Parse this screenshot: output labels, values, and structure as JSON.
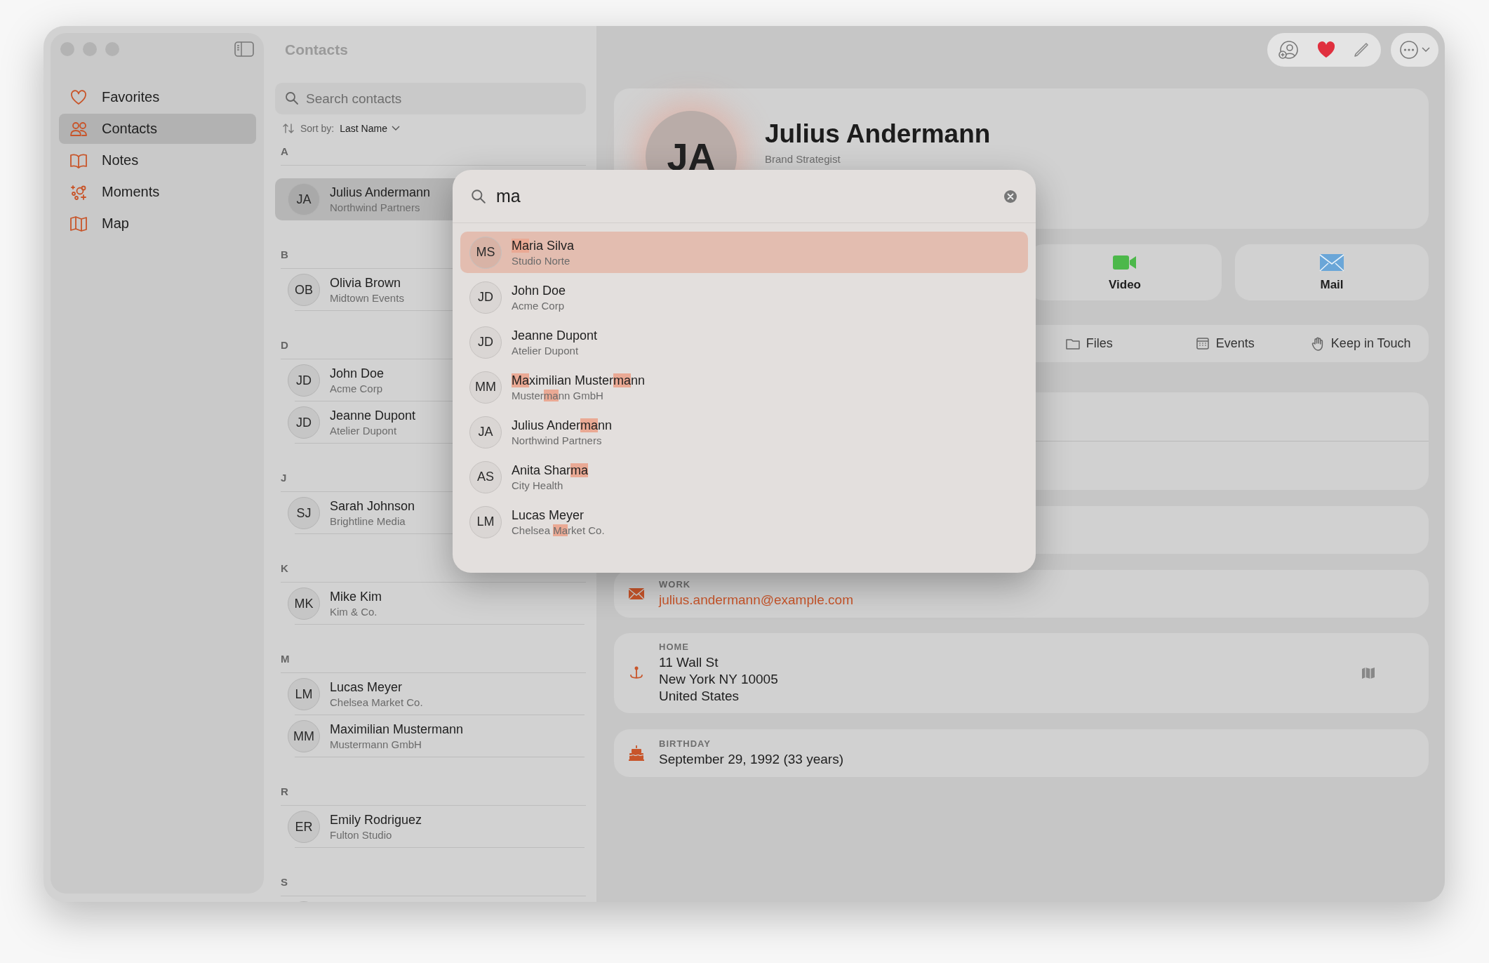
{
  "sidebar": {
    "items": [
      {
        "label": "Favorites",
        "selected": false
      },
      {
        "label": "Contacts",
        "selected": true
      },
      {
        "label": "Notes",
        "selected": false
      },
      {
        "label": "Moments",
        "selected": false
      },
      {
        "label": "Map",
        "selected": false
      }
    ]
  },
  "contact_list": {
    "title": "Contacts",
    "search": {
      "placeholder": "Search contacts"
    },
    "sort": {
      "label": "Sort by:",
      "value": "Last Name"
    },
    "sections": [
      {
        "letter": "A",
        "contacts": [
          {
            "initials": "JA",
            "name": "Julius Andermann",
            "company": "Northwind Partners",
            "selected": true
          }
        ]
      },
      {
        "letter": "B",
        "contacts": [
          {
            "initials": "OB",
            "name": "Olivia Brown",
            "company": "Midtown Events",
            "selected": false
          }
        ]
      },
      {
        "letter": "D",
        "contacts": [
          {
            "initials": "JD",
            "name": "John Doe",
            "company": "Acme Corp",
            "selected": false
          },
          {
            "initials": "JD",
            "name": "Jeanne Dupont",
            "company": "Atelier Dupont",
            "selected": false
          }
        ]
      },
      {
        "letter": "J",
        "contacts": [
          {
            "initials": "SJ",
            "name": "Sarah Johnson",
            "company": "Brightline Media",
            "selected": false
          }
        ]
      },
      {
        "letter": "K",
        "contacts": [
          {
            "initials": "MK",
            "name": "Mike Kim",
            "company": "Kim & Co.",
            "selected": false
          }
        ]
      },
      {
        "letter": "M",
        "contacts": [
          {
            "initials": "LM",
            "name": "Lucas Meyer",
            "company": "Chelsea Market Co.",
            "selected": false
          },
          {
            "initials": "MM",
            "name": "Maximilian Mustermann",
            "company": "Mustermann GmbH",
            "selected": false
          }
        ]
      },
      {
        "letter": "R",
        "contacts": [
          {
            "initials": "ER",
            "name": "Emily Rodriguez",
            "company": "Fulton Studio",
            "selected": false
          }
        ]
      },
      {
        "letter": "S",
        "contacts": [
          {
            "selected": false
          }
        ]
      }
    ]
  },
  "detail": {
    "initials": "JA",
    "name": "Julius Andermann",
    "title": "Brand Strategist",
    "actions": [
      {
        "label": "Video"
      },
      {
        "label": "Mail"
      }
    ],
    "tabs": [
      {
        "label": "Files"
      },
      {
        "label": "Events"
      },
      {
        "label": "Keep in Touch"
      }
    ],
    "fields": [
      {
        "kind": "email",
        "label": "WORK",
        "lines": [
          "julius.andermann@example.com"
        ]
      },
      {
        "kind": "address",
        "label": "HOME",
        "lines": [
          "11 Wall St",
          "New York NY 10005",
          "United States"
        ]
      },
      {
        "kind": "date",
        "label": "BIRTHDAY",
        "lines": [
          "September 29, 1992 (33 years)"
        ]
      }
    ]
  },
  "search_popup": {
    "query": "ma",
    "results": [
      {
        "initials": "MS",
        "selected": true,
        "name": [
          {
            "text": "Ma",
            "match": true
          },
          {
            "text": "ria Silva",
            "match": false
          }
        ],
        "company": [
          {
            "text": "Studio Norte",
            "match": false
          }
        ]
      },
      {
        "initials": "JD",
        "selected": false,
        "name": [
          {
            "text": "John Doe",
            "match": false
          }
        ],
        "company": [
          {
            "text": "Acme Corp",
            "match": false
          }
        ]
      },
      {
        "initials": "JD",
        "selected": false,
        "name": [
          {
            "text": "Jeanne Dupont",
            "match": false
          }
        ],
        "company": [
          {
            "text": "Atelier Dupont",
            "match": false
          }
        ]
      },
      {
        "initials": "MM",
        "selected": false,
        "name": [
          {
            "text": "Ma",
            "match": true
          },
          {
            "text": "ximilian Muster",
            "match": false
          },
          {
            "text": "ma",
            "match": true
          },
          {
            "text": "nn",
            "match": false
          }
        ],
        "company": [
          {
            "text": "Muster",
            "match": false
          },
          {
            "text": "ma",
            "match": true
          },
          {
            "text": "nn GmbH",
            "match": false
          }
        ]
      },
      {
        "initials": "JA",
        "selected": false,
        "name": [
          {
            "text": "Julius Ander",
            "match": false
          },
          {
            "text": "ma",
            "match": true
          },
          {
            "text": "nn",
            "match": false
          }
        ],
        "company": [
          {
            "text": "Northwind Partners",
            "match": false
          }
        ]
      },
      {
        "initials": "AS",
        "selected": false,
        "name": [
          {
            "text": "Anita Shar",
            "match": false
          },
          {
            "text": "ma",
            "match": true
          }
        ],
        "company": [
          {
            "text": "City Health",
            "match": false
          }
        ]
      },
      {
        "initials": "LM",
        "selected": false,
        "name": [
          {
            "text": "Lucas Meyer",
            "match": false
          }
        ],
        "company": [
          {
            "text": "Chelsea ",
            "match": false
          },
          {
            "text": "Ma",
            "match": true
          },
          {
            "text": "rket Co.",
            "match": false
          }
        ]
      }
    ]
  }
}
